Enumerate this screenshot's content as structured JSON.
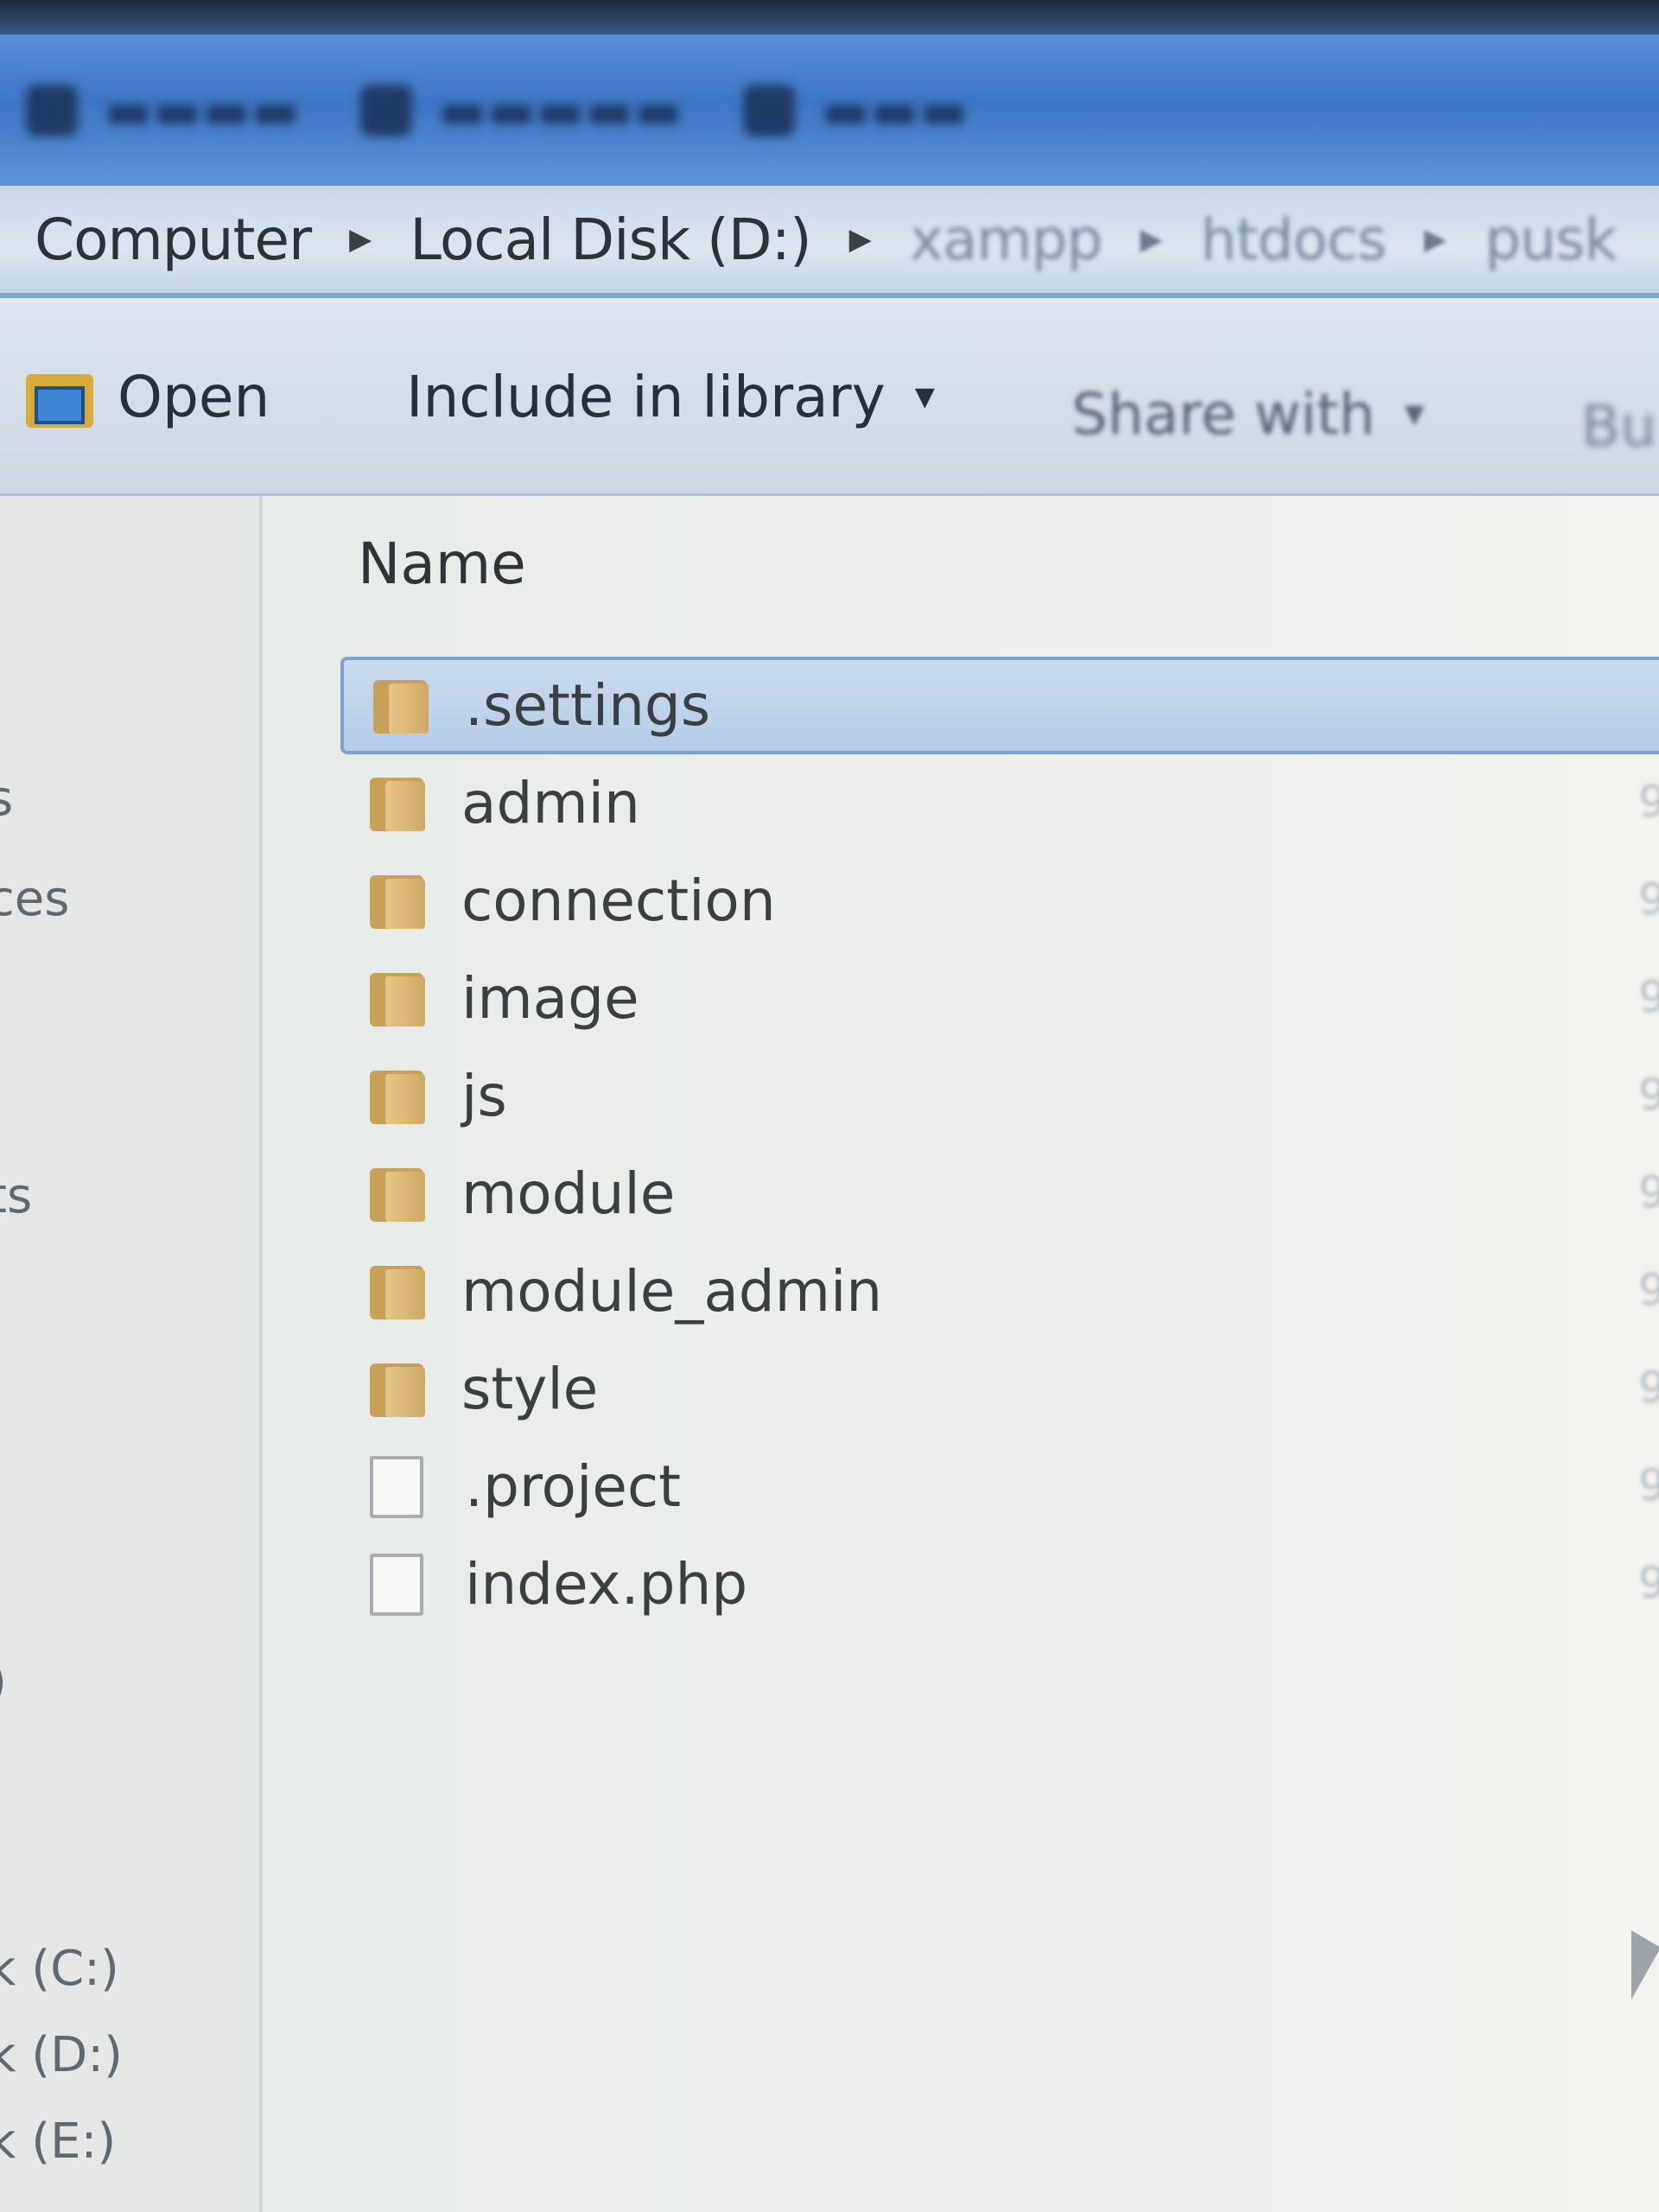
{
  "breadcrumb": [
    {
      "label": "Computer"
    },
    {
      "label": "Local Disk (D:)"
    },
    {
      "label": "xampp"
    },
    {
      "label": "htdocs"
    },
    {
      "label": "pusk"
    }
  ],
  "toolbar": {
    "open_label": "Open",
    "include_label": "Include in library",
    "share_label": "Share with",
    "burn_label": "Bu"
  },
  "nav_fragments": [
    {
      "text": "s"
    },
    {
      "text": "ces"
    },
    {
      "text": "ts"
    },
    {
      "text": ")"
    },
    {
      "text": "k (C:)"
    },
    {
      "text": "k (D:)"
    },
    {
      "text": "k (E:)"
    }
  ],
  "column_header": "Name",
  "files": [
    {
      "name": ".settings",
      "type": "folder",
      "selected": true
    },
    {
      "name": "admin",
      "type": "folder"
    },
    {
      "name": "connection",
      "type": "folder"
    },
    {
      "name": "image",
      "type": "folder"
    },
    {
      "name": "js",
      "type": "folder"
    },
    {
      "name": "module",
      "type": "folder"
    },
    {
      "name": "module_admin",
      "type": "folder"
    },
    {
      "name": "style",
      "type": "folder"
    },
    {
      "name": ".project",
      "type": "file"
    },
    {
      "name": "index.php",
      "type": "file"
    }
  ],
  "date_fragment": "9"
}
